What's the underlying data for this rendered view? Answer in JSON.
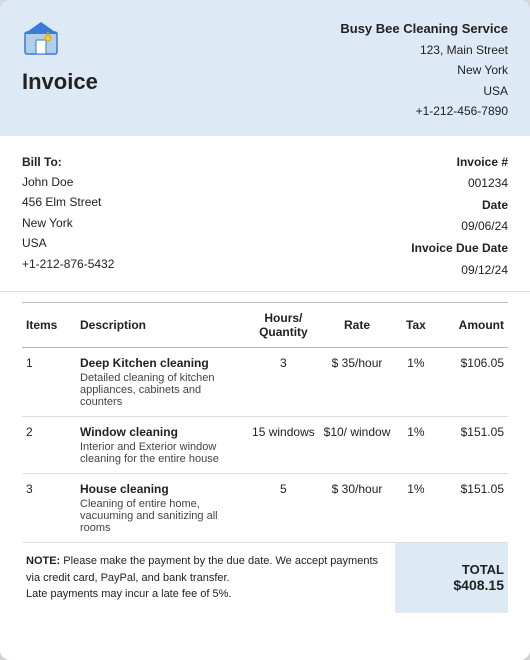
{
  "company": {
    "name": "Busy Bee Cleaning Service",
    "address_line1": "123, Main Street",
    "address_line2": "New York",
    "country": "USA",
    "phone": "+1-212-456-7890"
  },
  "invoice_title": "Invoice",
  "bill_to_label": "Bill To:",
  "client": {
    "name": "John Doe",
    "address_line1": "456 Elm Street",
    "address_line2": "New York",
    "country": "USA",
    "phone": "+1-212-876-5432"
  },
  "invoice_details": {
    "number_label": "Invoice #",
    "number": "001234",
    "date_label": "Date",
    "date": "09/06/24",
    "due_date_label": "Invoice Due Date",
    "due_date": "09/12/24"
  },
  "table": {
    "headers": {
      "items": "Items",
      "description": "Description",
      "hours_qty": "Hours/ Quantity",
      "rate": "Rate",
      "tax": "Tax",
      "amount": "Amount"
    },
    "rows": [
      {
        "num": "1",
        "desc_main": "Deep Kitchen cleaning",
        "desc_sub": "Detailed cleaning of kitchen appliances, cabinets and counters",
        "hours_qty": "3",
        "rate": "$ 35/hour",
        "tax": "1%",
        "amount": "$106.05"
      },
      {
        "num": "2",
        "desc_main": "Window cleaning",
        "desc_sub": "Interior and Exterior window cleaning for the entire house",
        "hours_qty": "15 windows",
        "rate": "$10/ window",
        "tax": "1%",
        "amount": "$151.05"
      },
      {
        "num": "3",
        "desc_main": "House cleaning",
        "desc_sub": "Cleaning of entire home, vacuuming and sanitizing all rooms",
        "hours_qty": "5",
        "rate": "$ 30/hour",
        "tax": "1%",
        "amount": "$151.05"
      }
    ]
  },
  "note": {
    "label": "NOTE:",
    "text": "Please make the payment by the due date. We accept payments via credit card, PayPal, and bank transfer.",
    "late_fee": "Late payments may incur a late fee of 5%."
  },
  "total": {
    "label": "TOTAL",
    "amount": "$408.15"
  }
}
